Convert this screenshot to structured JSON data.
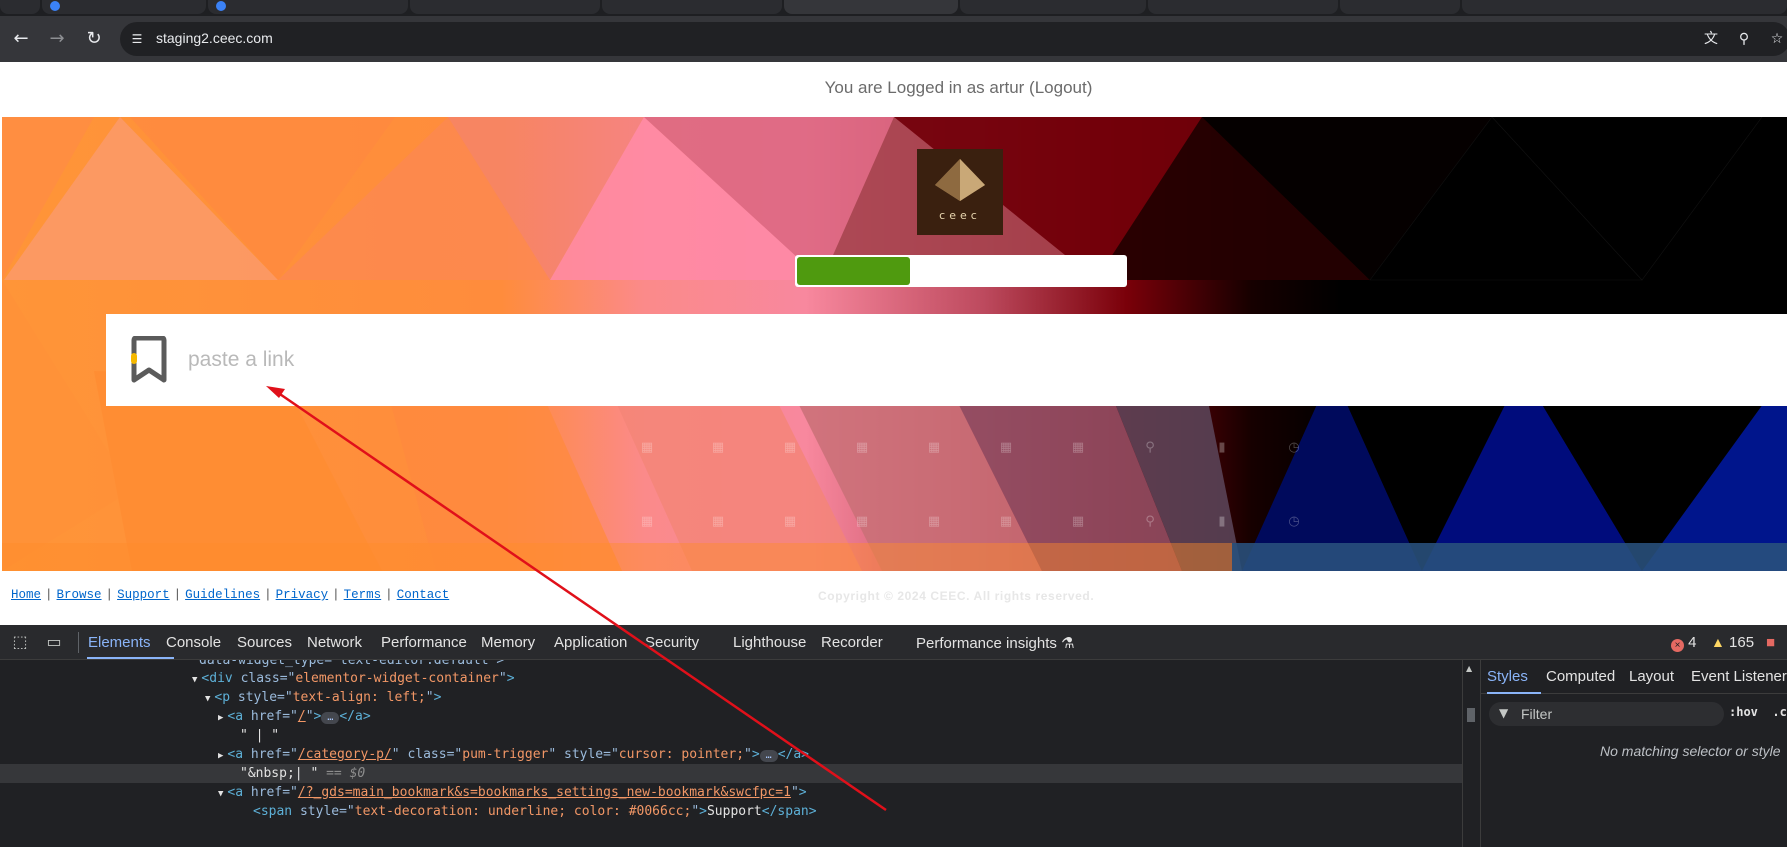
{
  "browser": {
    "url": "staging2.ceec.com",
    "back_icon": "arrow-left",
    "forward_icon": "arrow-right",
    "reload_icon": "reload"
  },
  "page": {
    "login_text": "You are Logged in as artur (Logout)",
    "logo_text": "ceec",
    "progress_fraction": 0.23,
    "link_placeholder": "paste a link",
    "footer_links": [
      "Home",
      "Browse",
      "Support",
      "Guidelines",
      "Privacy",
      "Terms",
      "Contact"
    ],
    "footer_sep": "|",
    "copyright": "Copyright © 2024 CEEC. All rights reserved."
  },
  "devtools": {
    "tabs": [
      "Elements",
      "Console",
      "Sources",
      "Network",
      "Performance",
      "Memory",
      "Application",
      "Security",
      "Lighthouse",
      "Recorder",
      "Performance insights"
    ],
    "active_tab": "Elements",
    "error_count": "4",
    "warning_count": "165",
    "dom_lines": [
      {
        "partial": "data-widget_type=\"text-editor.default\">"
      },
      {
        "open": "div",
        "attr": "class",
        "val": "elementor-widget-container"
      },
      {
        "open": "p",
        "attr": "style",
        "val": "text-align: left;"
      },
      {
        "open": "a",
        "attr": "href",
        "val": "/"
      },
      {
        "text": "\" | \""
      },
      {
        "open": "a",
        "attr": "href",
        "val": "/category-p/",
        "attr2": "class",
        "val2": "pum-trigger",
        "attr3": "style",
        "val3": "cursor: pointer;"
      },
      {
        "text": "\"&nbsp;| \"",
        "suffix": "== $0"
      },
      {
        "open": "a",
        "attr": "href",
        "val": "/?_gds=main_bookmark&s=bookmarks_settings_new-bookmark&swcfpc=1"
      },
      {
        "open": "span",
        "attr": "style",
        "val": "text-decoration: underline; color: #0066cc;",
        "inner": "Support",
        "close": "span"
      }
    ],
    "styles_tabs": [
      "Styles",
      "Computed",
      "Layout",
      "Event Listeners"
    ],
    "styles_active": "Styles",
    "filter_placeholder": "Filter",
    "hov_label": ":hov",
    "cls_label": ".cls",
    "no_match_text": "No matching selector or style"
  }
}
